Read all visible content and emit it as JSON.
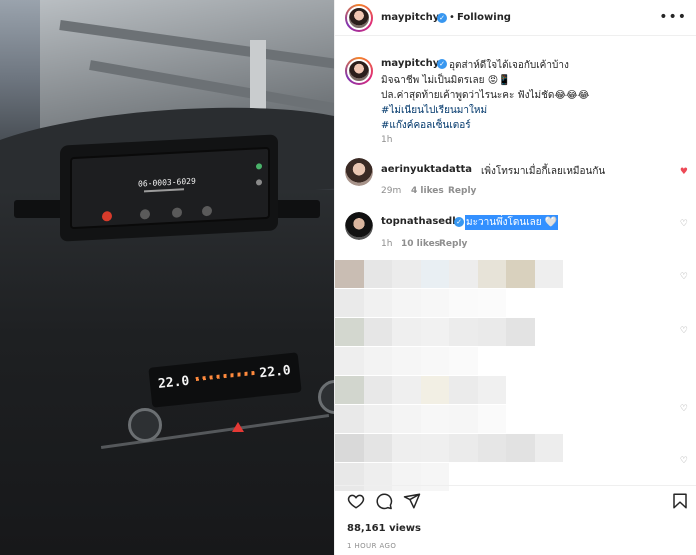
{
  "video": {
    "screen_number": "06-0003-6029",
    "temp_left": "22.0",
    "temp_right": "22.0"
  },
  "post": {
    "author": "maypitchy",
    "follow_status": "Following",
    "caption_lines": [
      "อุตส่าห์ดีใจได้เจอกับเค้าบ้าง",
      "มิจฉาชีพ ไม่เป็นมิตรเลย 😡📱",
      "ปล.ค่าสุดท้ายเค้าพูดว่าไรนะคะ ฟังไม่ชัด😂😂😂"
    ],
    "hashtags": [
      "#ไม่เนียนไปเรียนมาใหม่",
      "#แก๊งค์คอลเซ็นเตอร์"
    ],
    "caption_time": "1h",
    "views": "88,161 views",
    "posted": "1 HOUR AGO"
  },
  "comments": [
    {
      "user": "aerinyuktadatta",
      "text": "เพิ่งโทรมาเมื่อกี้เลยเหมือนกัน",
      "time": "29m",
      "likes": "4 likes",
      "reply": "Reply",
      "liked": true
    },
    {
      "user": "topnathasedh",
      "text": "มะวานพึ่งโดนเลย 🤍",
      "time": "1h",
      "likes": "10 likes",
      "reply": "Reply",
      "liked": false
    }
  ],
  "icons": {
    "more": "more-horizontal-icon",
    "like": "heart-icon",
    "comment": "comment-icon",
    "share": "paper-plane-icon",
    "save": "bookmark-icon"
  },
  "colors": {
    "verified": "#3897f0",
    "link": "#00376b",
    "muted": "#8e8e8e",
    "liked": "#ed4956",
    "selection": "#3390ff"
  }
}
